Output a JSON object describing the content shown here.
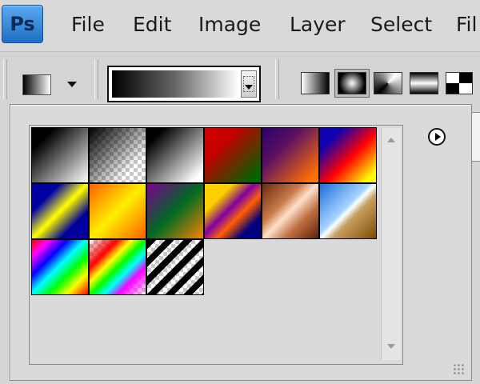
{
  "app": {
    "logo_text": "Ps"
  },
  "menu": [
    "File",
    "Edit",
    "Image",
    "Layer",
    "Select",
    "Fil"
  ],
  "options_bar": {
    "tool_preset_icon": "gradient-tool-preset-icon",
    "current_gradient": "black-white",
    "gradient_types": [
      "linear",
      "radial",
      "angle",
      "reflected",
      "diamond"
    ],
    "selected_gradient_type": "radial"
  },
  "gradient_picker": {
    "menu_icon": "flyout-menu-arrow-icon",
    "presets": [
      {
        "name": "foreground-to-background",
        "css": "linear-gradient(135deg,#000 0%,#000 20%,#fff 100%)"
      },
      {
        "name": "foreground-to-transparent",
        "css": "linear-gradient(135deg,#000 0%,rgba(0,0,0,0.55) 35%,rgba(0,0,0,0) 75%)",
        "checker": true
      },
      {
        "name": "black-white",
        "css": "linear-gradient(135deg,#000 0%,#000 15%,#fff 90%)"
      },
      {
        "name": "red-green",
        "css": "linear-gradient(135deg,#d40000 0%,#c40000 30%,#006400 90%)"
      },
      {
        "name": "violet-orange",
        "css": "linear-gradient(135deg,#2a006a 0%,#5a1060 35%,#ff7000 90%)"
      },
      {
        "name": "blue-red-yellow",
        "css": "linear-gradient(135deg,#1000b0 0%,#1000b0 20%,#ff0000 55%,#ffff00 90%)"
      },
      {
        "name": "blue-yellow-blue",
        "css": "linear-gradient(135deg,#0000a0 0%,#0000a0 25%,#ffff00 50%,#0000a0 75%,#0000a0 100%)"
      },
      {
        "name": "orange-yellow-orange",
        "css": "linear-gradient(135deg,#ff6000 0%,#ffee00 50%,#ff6000 100%)"
      },
      {
        "name": "violet-green-orange",
        "css": "linear-gradient(135deg,#7a0090 0%,#006a20 50%,#ff8000 100%)"
      },
      {
        "name": "yellow-violet-orange-blue",
        "css": "linear-gradient(135deg,#ffd000 0%,#ffd000 25%,#8000a0 45%,#ff6000 60%,#000080 80%)"
      },
      {
        "name": "copper",
        "css": "linear-gradient(135deg,#6b2a10 0%,#c87a4a 35%,#ffe0cc 50%,#c07040 70%,#5a2008 100%)"
      },
      {
        "name": "chrome",
        "css": "linear-gradient(135deg,#1c6fd8 0%,#a8d4ff 45%,#ffffff 50%,#c9a060 60%,#7a4a00 100%)"
      },
      {
        "name": "spectrum",
        "css": "linear-gradient(135deg,#ff0000 0%,#ff00ff 15%,#0000ff 32%,#00ffff 48%,#00ff00 64%,#ffff00 80%,#ff0000 100%)"
      },
      {
        "name": "transparent-rainbow",
        "css": "linear-gradient(135deg,rgba(255,0,0,0) 0%,#ff0000 25%,#ffff00 38%,#00ff00 50%,#00ffff 62%,#ff00ff 75%,rgba(255,0,255,0) 100%)",
        "checker": true
      },
      {
        "name": "transparent-stripes",
        "css": "repeating-linear-gradient(135deg,#000 0px,#000 8px,rgba(0,0,0,0) 8px,rgba(0,0,0,0) 16px)",
        "checker": true
      }
    ]
  },
  "colors": {
    "ui_bg": "#d6d6d6",
    "ps_logo_blue": "#2a7fd4"
  }
}
